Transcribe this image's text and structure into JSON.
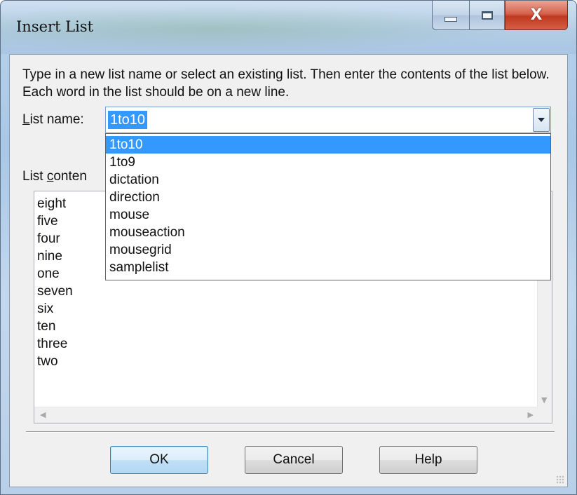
{
  "window": {
    "title": "Insert List",
    "close_symbol": "X"
  },
  "dialog": {
    "instructions": "Type in a new list name or select an existing list. Then enter the contents of the list below. Each word in the list should be on a new line.",
    "list_name_label_prefix": "",
    "list_name_label_mnemonic": "L",
    "list_name_label_rest": "ist name:",
    "list_name_value": "1to10",
    "list_contents_label_prefix": "List ",
    "list_contents_label_mnemonic": "c",
    "list_contents_label_rest": "onten",
    "dropdown_options": [
      "1to10",
      "1to9",
      "dictation",
      "direction",
      "mouse",
      "mouseaction",
      "mousegrid",
      "samplelist"
    ],
    "selected_option": "1to10",
    "list_contents": [
      "eight",
      "five",
      "four",
      "nine",
      "one",
      "seven",
      "six",
      "ten",
      "three",
      "two"
    ]
  },
  "buttons": {
    "ok": "OK",
    "cancel": "Cancel",
    "help": "Help"
  },
  "icons": {
    "minimize": "minimize-icon",
    "maximize": "maximize-icon",
    "close": "close-icon",
    "dropdown": "chevron-down-icon"
  },
  "colors": {
    "selection": "#3399ff",
    "close_button": "#c0391f"
  }
}
